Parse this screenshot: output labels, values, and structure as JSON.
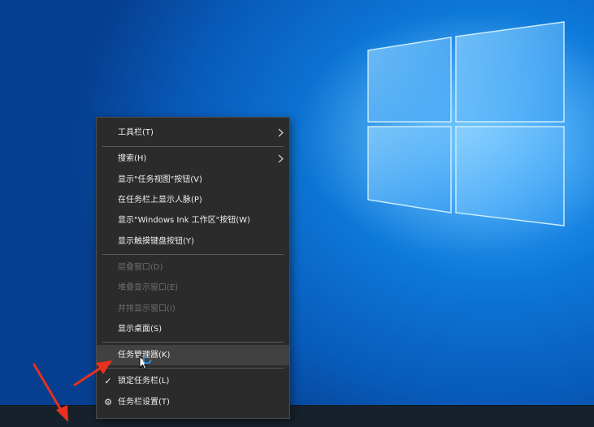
{
  "colors": {
    "desktop_accent": "#0d78d8",
    "menu_bg": "#2b2b2b",
    "menu_text": "#f0f0f0",
    "menu_disabled_text": "#6e6e6e",
    "hover_bg": "#414141",
    "annotation_arrow": "#e8301f",
    "taskbar_bg": "#17212c"
  },
  "context_menu": {
    "toolbars": "工具栏(T)",
    "search": "搜索(H)",
    "show_task_view": "显示\"任务视图\"按钮(V)",
    "show_people": "在任务栏上显示人脉(P)",
    "show_ink": "显示\"Windows Ink 工作区\"按钮(W)",
    "show_touch_keyboard": "显示触摸键盘按钮(Y)",
    "cascade": "层叠窗口(D)",
    "stack": "堆叠显示窗口(E)",
    "side_by_side": "并排显示窗口(I)",
    "show_desktop": "显示桌面(S)",
    "task_manager": "任务管理器(K)",
    "lock_taskbar": "锁定任务栏(L)",
    "taskbar_settings": "任务栏设置(T)"
  },
  "icons": {
    "submenu": "chevron-right-icon",
    "lock_check": "check-icon",
    "settings": "gear-icon",
    "pointer": "mouse-cursor-icon",
    "annotation": "red-arrow-icon"
  }
}
